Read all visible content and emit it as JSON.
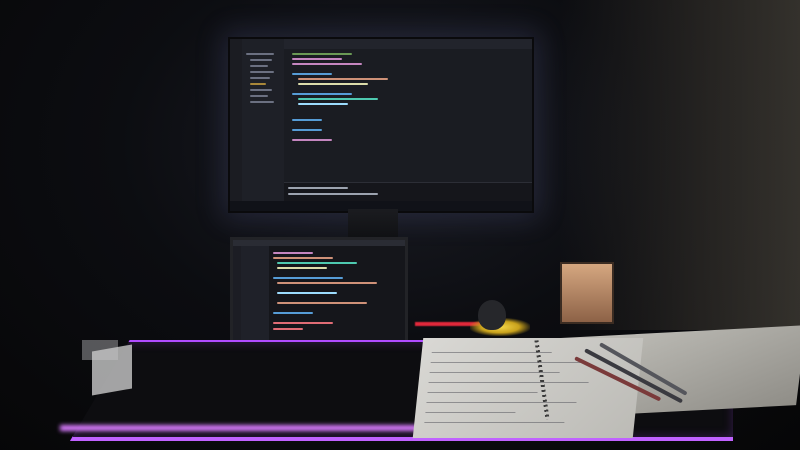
{
  "scene": {
    "description_tags": [
      "desk-setup",
      "monitor",
      "laptop",
      "notebook",
      "rgb-desk-mat"
    ],
    "colors": {
      "desk_mat_glow": "#b04bff",
      "mouse_glow": "#f4d64a",
      "monitor_bg": "#1a1c22",
      "shirt": "#e36a1c"
    }
  },
  "icons": [
    "monitor-icon",
    "laptop-icon",
    "mouse-icon",
    "pen-icon"
  ]
}
